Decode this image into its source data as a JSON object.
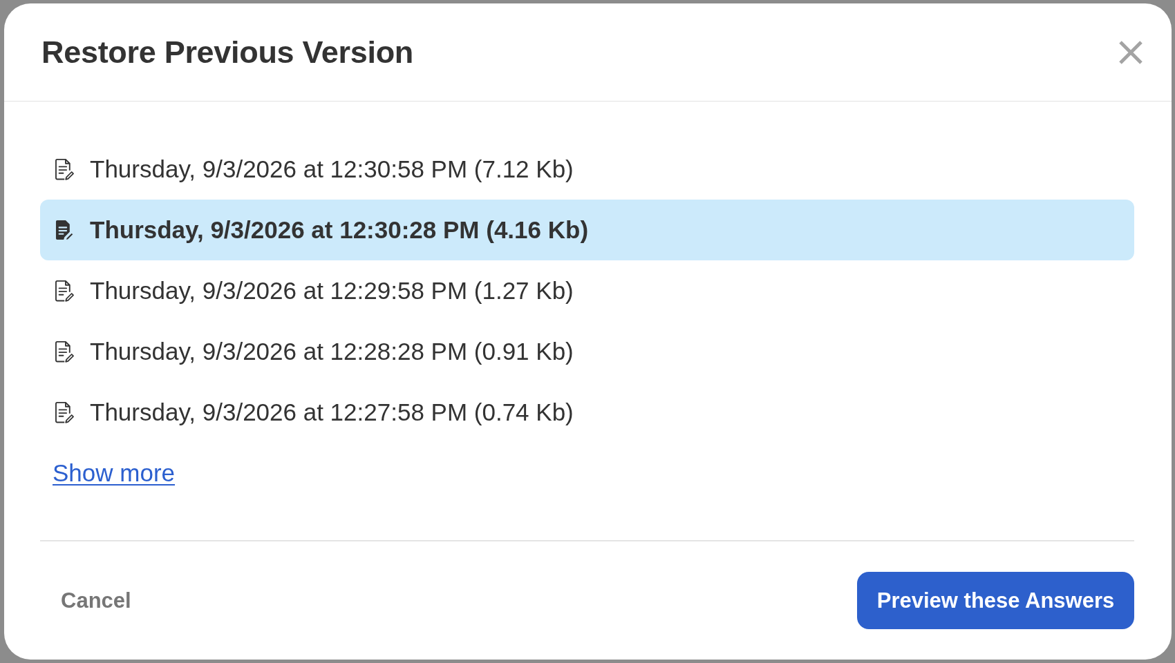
{
  "dialog": {
    "title": "Restore Previous Version",
    "versions": [
      {
        "label": "Thursday, 9/3/2026 at 12:30:58 PM (7.12 Kb)",
        "selected": false
      },
      {
        "label": "Thursday, 9/3/2026 at 12:30:28 PM (4.16 Kb)",
        "selected": true
      },
      {
        "label": "Thursday, 9/3/2026 at 12:29:58 PM (1.27 Kb)",
        "selected": false
      },
      {
        "label": "Thursday, 9/3/2026 at 12:28:28 PM (0.91 Kb)",
        "selected": false
      },
      {
        "label": "Thursday, 9/3/2026 at 12:27:58 PM (0.74 Kb)",
        "selected": false
      }
    ],
    "show_more_link": "Show more",
    "cancel_button": "Cancel",
    "primary_button": "Preview these Answers"
  }
}
